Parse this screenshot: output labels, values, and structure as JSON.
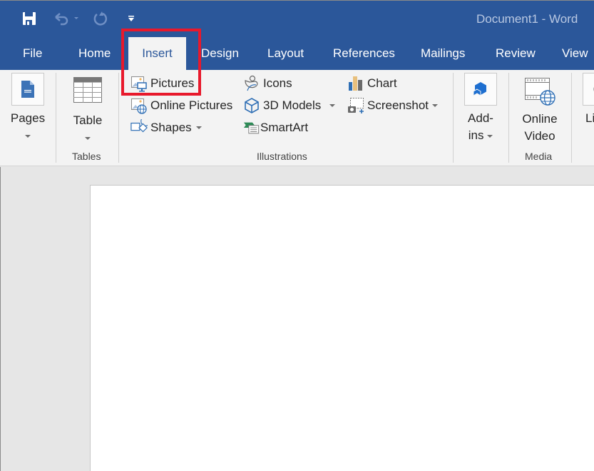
{
  "window": {
    "title": "Document1  -  Word"
  },
  "quick_access": {
    "save_icon": "save-icon",
    "undo_icon": "undo-icon",
    "redo_icon": "redo-icon",
    "customize_icon": "customize-qat-icon"
  },
  "tabs": [
    {
      "label": "File"
    },
    {
      "label": "Home"
    },
    {
      "label": "Insert",
      "active": true
    },
    {
      "label": "Design"
    },
    {
      "label": "Layout"
    },
    {
      "label": "References"
    },
    {
      "label": "Mailings"
    },
    {
      "label": "Review"
    },
    {
      "label": "View"
    }
  ],
  "ribbon": {
    "pages": {
      "label": "Pages",
      "icon": "pages-icon"
    },
    "tables": {
      "group_label": "Tables",
      "table_label": "Table",
      "icon": "table-icon"
    },
    "illustrations": {
      "group_label": "Illustrations",
      "pictures": "Pictures",
      "online_pictures": "Online Pictures",
      "shapes": "Shapes",
      "icons": "Icons",
      "models_3d": "3D Models",
      "smartart": "SmartArt",
      "chart": "Chart",
      "screenshot": "Screenshot"
    },
    "addins": {
      "label_line1": "Add-",
      "label_line2": "ins",
      "icon": "addins-icon"
    },
    "media": {
      "group_label": "Media",
      "label_line1": "Online",
      "label_line2": "Video",
      "icon": "online-video-icon"
    },
    "links": {
      "label_partial": "Li"
    }
  },
  "colors": {
    "brand_blue": "#2b579a",
    "highlight_red": "#e8192c"
  }
}
